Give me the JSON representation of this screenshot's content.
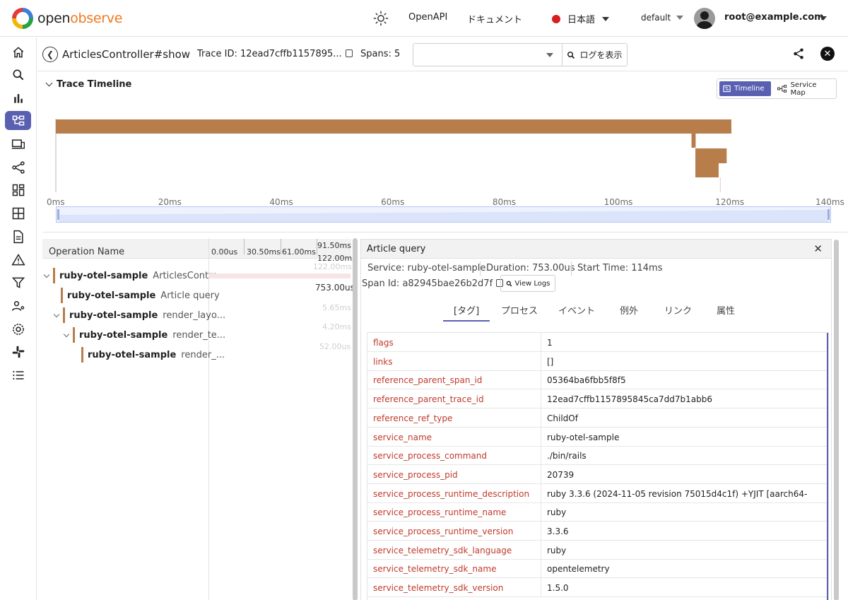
{
  "app": {
    "logo_prefix": "open",
    "logo_suffix": "observe",
    "openapi_label": "OpenAPI",
    "docs_label": "ドキュメント",
    "language_label": "日本語",
    "org_label": "default",
    "user_email": "root@example.com"
  },
  "sidebar": {
    "items": [
      {
        "name": "home-icon"
      },
      {
        "name": "search-icon"
      },
      {
        "name": "bar-chart-icon"
      },
      {
        "name": "traces-icon",
        "active": true
      },
      {
        "name": "devices-icon"
      },
      {
        "name": "pipeline-icon"
      },
      {
        "name": "dashboards-icon"
      },
      {
        "name": "grid-icon"
      },
      {
        "name": "reports-icon"
      },
      {
        "name": "alerts-icon"
      },
      {
        "name": "filter-icon"
      },
      {
        "name": "iam-icon"
      },
      {
        "name": "settings-icon"
      },
      {
        "name": "slack-icon"
      },
      {
        "name": "list-icon"
      }
    ],
    "accent_color": "#5960b2"
  },
  "header": {
    "trace_name": "ArticlesController#show",
    "trace_id_label": "Trace ID: 12ead7cffb1157895...",
    "spans_label": "Spans: 5",
    "select_value": "",
    "log_button_label": "ログを表示"
  },
  "timeline": {
    "title": "Trace Timeline",
    "toggle_timeline": "Timeline",
    "toggle_service_map": "Service Map",
    "axis_ticks": [
      "0ms",
      "20ms",
      "40ms",
      "60ms",
      "80ms",
      "100ms",
      "120ms",
      "140ms"
    ],
    "bar_color": "#b77d4b",
    "total_ms": 140,
    "spans": [
      {
        "start_ms": 0,
        "duration_ms": 122
      },
      {
        "start_ms": 114.8,
        "duration_ms": 0.75
      },
      {
        "start_ms": 115.5,
        "duration_ms": 5.65
      },
      {
        "start_ms": 115.5,
        "duration_ms": 4.2
      }
    ]
  },
  "spans_table": {
    "header_label": "Operation Name",
    "column_ticks": [
      "0.00us",
      "30.50ms",
      "61.00ms",
      "91.50ms",
      "122.00ms"
    ],
    "rows": [
      {
        "service": "ruby-otel-sample",
        "operation": "ArticlesContro...",
        "duration": "122.00ms",
        "level": 0,
        "collapsible": true
      },
      {
        "service": "ruby-otel-sample",
        "operation": "Article query",
        "duration": "753.00us",
        "level": 1,
        "collapsible": false
      },
      {
        "service": "ruby-otel-sample",
        "operation": "render_layo...",
        "duration": "5.65ms",
        "level": 0,
        "collapsible": true
      },
      {
        "service": "ruby-otel-sample",
        "operation": "render_te...",
        "duration": "4.20ms",
        "level": 1,
        "collapsible": true
      },
      {
        "service": "ruby-otel-sample",
        "operation": "render_...",
        "duration": "52.00us",
        "level": 2,
        "collapsible": false
      }
    ]
  },
  "detail": {
    "title": "Article query",
    "service_label": "Service: ruby-otel-sample",
    "duration_label": "Duration: 753.00us",
    "start_label": "Start Time: 114ms",
    "span_id_label": "Span Id: a82945bae26b2d7f",
    "view_logs_label": "View Logs",
    "tabs": [
      "[タグ]",
      "プロセス",
      "イベント",
      "例外",
      "リンク",
      "属性"
    ],
    "tags": [
      {
        "key": "flags",
        "value": "1"
      },
      {
        "key": "links",
        "value": "[]"
      },
      {
        "key": "reference_parent_span_id",
        "value": "05364ba6fbb5f8f5"
      },
      {
        "key": "reference_parent_trace_id",
        "value": "12ead7cffb1157895845ca7dd7b1abb6"
      },
      {
        "key": "reference_ref_type",
        "value": "ChildOf"
      },
      {
        "key": "service_name",
        "value": "ruby-otel-sample"
      },
      {
        "key": "service_process_command",
        "value": "./bin/rails"
      },
      {
        "key": "service_process_pid",
        "value": "20739"
      },
      {
        "key": "service_process_runtime_description",
        "value": "ruby 3.3.6 (2024-11-05 revision 75015d4c1f) +YJIT [aarch64-"
      },
      {
        "key": "service_process_runtime_name",
        "value": "ruby"
      },
      {
        "key": "service_process_runtime_version",
        "value": "3.3.6"
      },
      {
        "key": "service_telemetry_sdk_language",
        "value": "ruby"
      },
      {
        "key": "service_telemetry_sdk_name",
        "value": "opentelemetry"
      },
      {
        "key": "service_telemetry_sdk_version",
        "value": "1.5.0"
      }
    ]
  }
}
